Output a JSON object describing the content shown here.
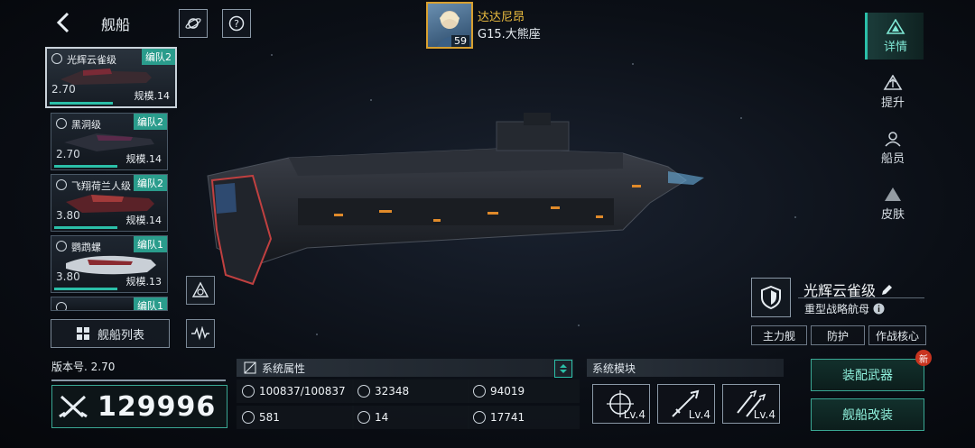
{
  "header": {
    "title": "舰船"
  },
  "commander": {
    "name": "达达尼昂",
    "level": "59",
    "location": "G15.大熊座"
  },
  "ship_list": [
    {
      "name": "光辉云雀级",
      "fleet": "编队2",
      "version": "2.70",
      "scale": "规模.14",
      "selected": true
    },
    {
      "name": "黑洞级",
      "fleet": "编队2",
      "version": "2.70",
      "scale": "规模.14",
      "selected": false
    },
    {
      "name": "飞翔荷兰人级",
      "fleet": "编队2",
      "version": "3.80",
      "scale": "规模.14",
      "selected": false
    },
    {
      "name": "鹦鹉螺",
      "fleet": "编队1",
      "version": "3.80",
      "scale": "规模.13",
      "selected": false
    },
    {
      "name": "",
      "fleet": "编队1",
      "version": "",
      "scale": "",
      "selected": false
    }
  ],
  "list_button": "舰船列表",
  "tabs": [
    {
      "label": "详情",
      "active": true
    },
    {
      "label": "提升",
      "active": false
    },
    {
      "label": "船员",
      "active": false
    },
    {
      "label": "皮肤",
      "active": false
    }
  ],
  "ship": {
    "name": "光辉云雀级",
    "type": "重型战略航母",
    "tags": [
      "主力舰",
      "防护",
      "作战核心"
    ]
  },
  "version_text": "版本号. 2.70",
  "power": "129996",
  "attributes": {
    "header": "系统属性",
    "values": [
      "100837/100837",
      "32348",
      "94019",
      "581",
      "14",
      "17741"
    ]
  },
  "modules": {
    "header": "系统模块",
    "levels": [
      "Lv.4",
      "Lv.4",
      "Lv.4"
    ]
  },
  "actions": {
    "equip": "装配武器",
    "modify": "舰船改装",
    "new_badge": "新"
  },
  "colors": {
    "accent": "#2bbfa8",
    "gold": "#f0c040",
    "badge": "#c8341f"
  }
}
